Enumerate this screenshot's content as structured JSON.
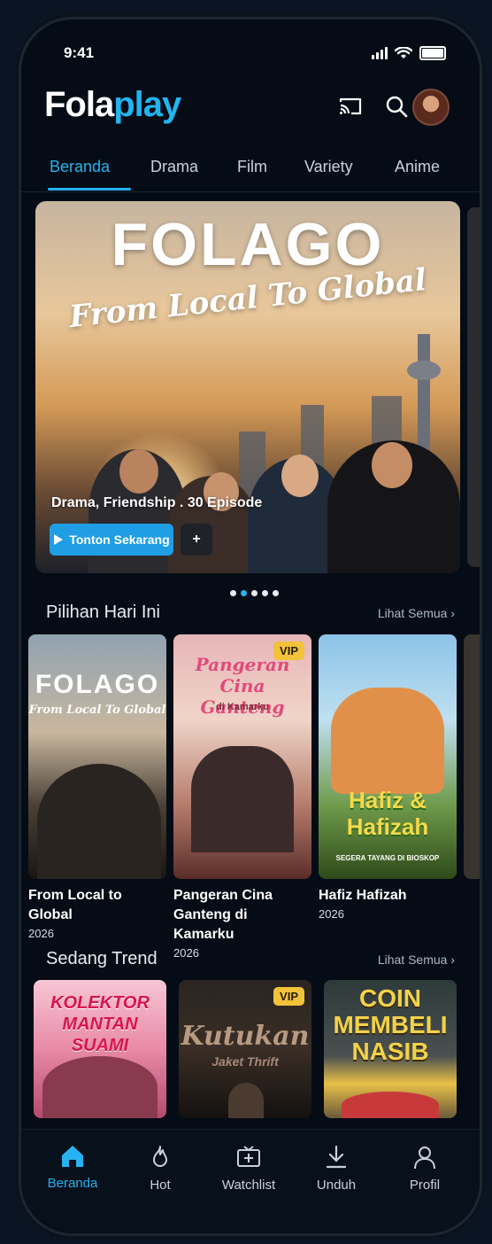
{
  "status": {
    "time": "9:41"
  },
  "app": {
    "logo_part1": "Fola",
    "logo_part2": "play"
  },
  "tabs": [
    "Beranda",
    "Drama",
    "Film",
    "Variety",
    "Anime"
  ],
  "hero": {
    "title": "FOLAGO",
    "subtitle": "From Local To Global",
    "genre": "Drama, Friendship . 30 Episode",
    "play_label": "Tonton Sekarang",
    "add_label": "+"
  },
  "sections": {
    "today": {
      "title": "Pilihan Hari Ini",
      "see_all": "Lihat Semua"
    },
    "trending": {
      "title": "Sedang Trend",
      "see_all": "Lihat Semua"
    }
  },
  "today_items": [
    {
      "poster_text": "FOLAGO",
      "poster_sub": "From Local To Global",
      "title": "From Local to Global",
      "year": "2026",
      "vip": false
    },
    {
      "poster_text": "Pangeran Cina Ganteng",
      "poster_sub": "di Kamarku",
      "title": "Pangeran Cina Ganteng di Kamarku",
      "year": "2026",
      "vip": true,
      "vip_label": "VIP"
    },
    {
      "poster_text": "Hafiz & Hafizah",
      "poster_sub": "SEGERA TAYANG DI BIOSKOP",
      "title": "Hafiz Hafizah",
      "year": "2026",
      "vip": false
    }
  ],
  "trending_items": [
    {
      "poster_text": "KOLEKTOR MANTAN SUAMI",
      "vip": false
    },
    {
      "poster_text": "Kutukan",
      "poster_sub": "Jaket Thrift",
      "vip": true,
      "vip_label": "VIP"
    },
    {
      "poster_text": "COIN MEMBELI NASIB",
      "vip": false
    }
  ],
  "bottom_nav": [
    "Beranda",
    "Hot",
    "Watchlist",
    "Unduh",
    "Profil"
  ],
  "colors": {
    "accent": "#27b2f0",
    "background": "#050c16",
    "vip": "#f2c23b"
  },
  "icons": [
    "cast-icon",
    "search-icon",
    "avatar",
    "home-icon",
    "fire-icon",
    "watchlist-icon",
    "download-icon",
    "profile-icon",
    "chevron-right-icon",
    "play-icon"
  ]
}
